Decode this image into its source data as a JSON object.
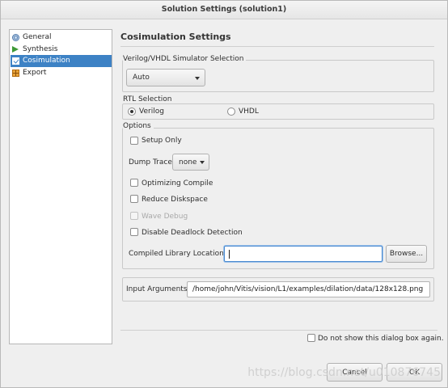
{
  "window": {
    "title": "Solution Settings (solution1)"
  },
  "sidebar": {
    "items": [
      {
        "label": "General",
        "icon": "general-icon",
        "selected": false
      },
      {
        "label": "Synthesis",
        "icon": "play-icon",
        "selected": false
      },
      {
        "label": "Cosimulation",
        "icon": "checkbox-icon",
        "selected": true
      },
      {
        "label": "Export",
        "icon": "export-icon",
        "selected": false
      }
    ]
  },
  "main": {
    "title": "Cosimulation Settings",
    "simulator": {
      "group_label": "Verilog/VHDL Simulator Selection",
      "selected": "Auto"
    },
    "rtl": {
      "group_label": "RTL Selection",
      "options": [
        {
          "label": "Verilog",
          "checked": true
        },
        {
          "label": "VHDL",
          "checked": false
        }
      ]
    },
    "options": {
      "group_label": "Options",
      "setup_only": {
        "label": "Setup Only",
        "checked": false
      },
      "dump_trace": {
        "label": "Dump Trace",
        "value": "none"
      },
      "optimizing_compile": {
        "label": "Optimizing Compile",
        "checked": false
      },
      "reduce_diskspace": {
        "label": "Reduce Diskspace",
        "checked": false
      },
      "wave_debug": {
        "label": "Wave Debug",
        "checked": false,
        "disabled": true
      },
      "disable_deadlock": {
        "label": "Disable Deadlock Detection",
        "checked": false
      },
      "compiled_library": {
        "label": "Compiled Library Location",
        "value": "",
        "browse_label": "Browse..."
      }
    },
    "input_arguments": {
      "label": "Input Arguments",
      "value": "/home/john/Vitis/vision/L1/examples/dilation/data/128x128.png"
    }
  },
  "footer": {
    "dont_show_label": "Do not show this dialog box again.",
    "cancel_label": "Cancel",
    "ok_label": "OK"
  },
  "watermark": "https://blog.csdn.net/u010876745",
  "colors": {
    "selection": "#3d82c5",
    "background": "#efefef",
    "focus_border": "#4a8ad0"
  }
}
